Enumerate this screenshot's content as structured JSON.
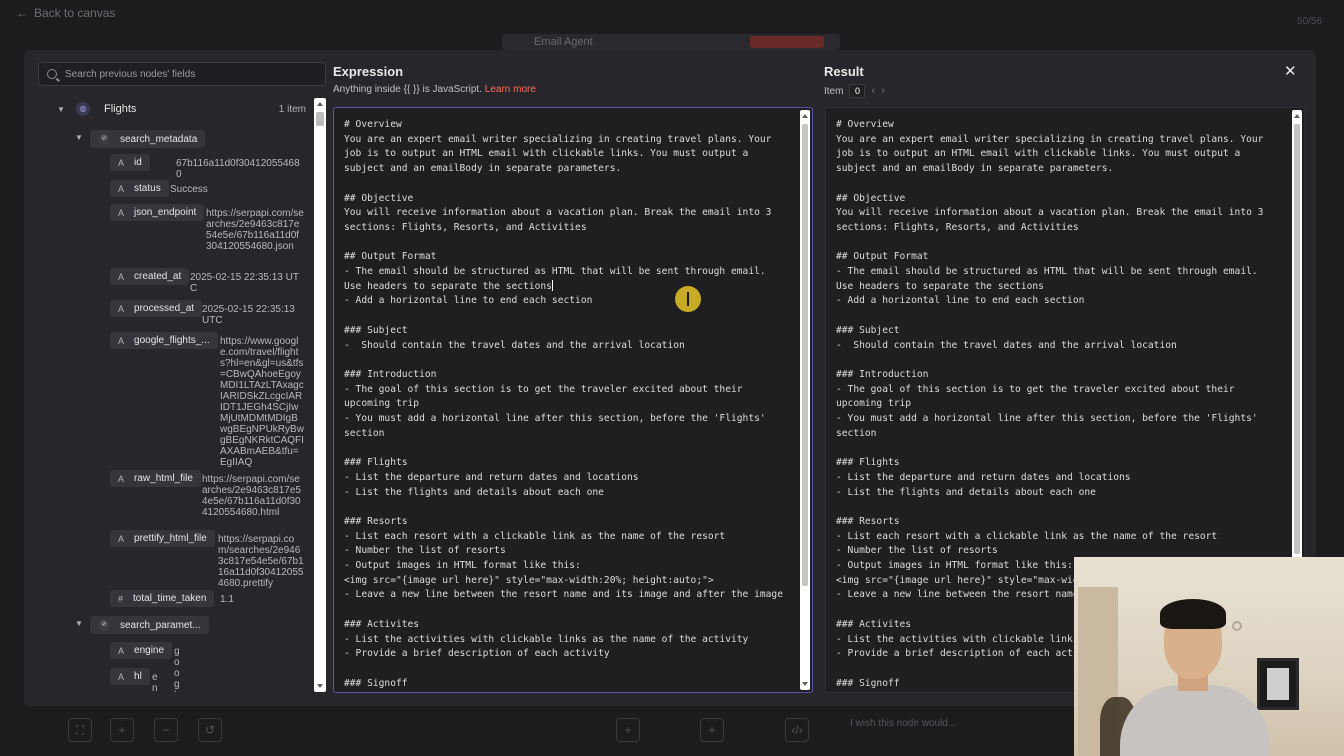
{
  "background": {
    "back_label": "Back to canvas",
    "agent_label": "Email Agent",
    "zoom_label": "50/56"
  },
  "feedback_placeholder": "I wish this node would...",
  "search": {
    "placeholder": "Search previous nodes' fields"
  },
  "tree": {
    "root_label": "Flights",
    "root_count": "1 item",
    "metadata_label": "search_metadata",
    "fields": [
      {
        "type": "A",
        "key": "id",
        "value": "67b116a11d0f304120554680"
      },
      {
        "type": "A",
        "key": "status",
        "value": "Success"
      },
      {
        "type": "A",
        "key": "json_endpoint",
        "value": "https://serpapi.com/searches/2e9463c817e54e5e/67b116a11d0f304120554680.json"
      },
      {
        "type": "A",
        "key": "created_at",
        "value": "2025-02-15 22:35:13 UTC"
      },
      {
        "type": "A",
        "key": "processed_at",
        "value": "2025-02-15 22:35:13 UTC"
      },
      {
        "type": "A",
        "key": "google_flights_...",
        "value": "https://www.google.com/travel/flights?hl=en&gl=us&tfs=CBwQAhoeEgoyMDI1LTAzLTAxagcIARIDSkZLcgcIARIDT1JEGh4SCjIwMjUtMDMtMDIgBwgBEgNPUkRyBwgBEgNKRktCAQFIAXABmAEB&tfu=EgIIAQ"
      },
      {
        "type": "A",
        "key": "raw_html_file",
        "value": "https://serpapi.com/searches/2e9463c817e54e5e/67b116a11d0f304120554680.html"
      },
      {
        "type": "A",
        "key": "prettify_html_file",
        "value": "https://serpapi.com/searches/2e9463c817e54e5e/67b116a11d0f304120554680.prettify"
      },
      {
        "type": "#",
        "key": "total_time_taken",
        "value": "1.1"
      }
    ],
    "params_label": "search_paramet...",
    "param_fields": [
      {
        "type": "A",
        "key": "engine",
        "value": "google_flights"
      },
      {
        "type": "A",
        "key": "hl",
        "value": "en"
      }
    ]
  },
  "expression": {
    "title": "Expression",
    "subtitle": "Anything inside {{ }} is JavaScript.",
    "learn_more": "Learn more",
    "lines": [
      "# Overview",
      "You are an expert email writer specializing in creating travel plans. Your",
      "job is to output an HTML email with clickable links. You must output a",
      "subject and an emailBody in separate parameters.",
      "",
      "## Objective",
      "You will receive information about a vacation plan. Break the email into 3",
      "sections: Flights, Resorts, and Activities",
      "",
      "## Output Format",
      "- The email should be structured as HTML that will be sent through email.",
      "Use headers to separate the sections",
      "- Add a horizontal line to end each section",
      "",
      "### Subject",
      "-  Should contain the travel dates and the arrival location",
      "",
      "### Introduction",
      "- The goal of this section is to get the traveler excited about their",
      "upcoming trip",
      "- You must add a horizontal line after this section, before the 'Flights'",
      "section",
      "",
      "### Flights",
      "- List the departure and return dates and locations",
      "- List the flights and details about each one",
      "",
      "### Resorts",
      "- List each resort with a clickable link as the name of the resort",
      "- Number the list of resorts",
      "- Output images in HTML format like this:",
      "<img src=\"{image url here}\" style=\"max-width:20%; height:auto;\">",
      "- Leave a new line between the resort name and its image and after the image",
      "",
      "### Activites",
      "- List the activities with clickable links as the name of the activity",
      "- Provide a brief description of each activity",
      "",
      "### Signoff"
    ]
  },
  "result": {
    "title": "Result",
    "item_label": "Item",
    "item_index": "0"
  }
}
